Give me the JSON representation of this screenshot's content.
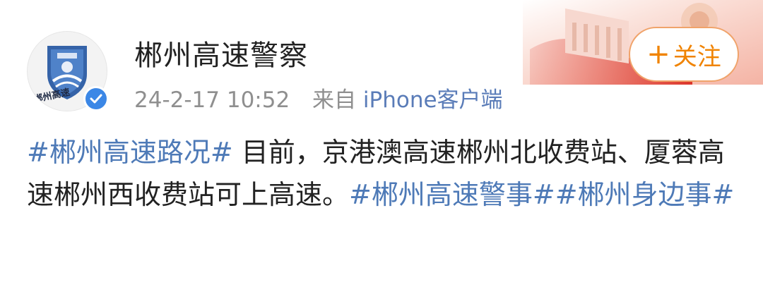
{
  "account": {
    "name": "郴州高速警察",
    "avatar_watermark": "郴州高速",
    "verified_icon": "verified-check-icon"
  },
  "post": {
    "date_time": "24-2-17 10:52",
    "via_label": "来自",
    "via_app": "iPhone客户端",
    "hashtag_1": "#郴州高速路况#",
    "text_1": " 目前，京港澳高速郴州北收费站、厦蓉高速郴州西收费站可上高速。",
    "hashtag_2": "#郴州高速警事#",
    "hashtag_3": "#郴州身边事#"
  },
  "follow_button": {
    "plus": "+",
    "label": "关注"
  },
  "colors": {
    "link": "#4e7ab7",
    "follow": "#f08300",
    "verified": "#3b87e6"
  }
}
